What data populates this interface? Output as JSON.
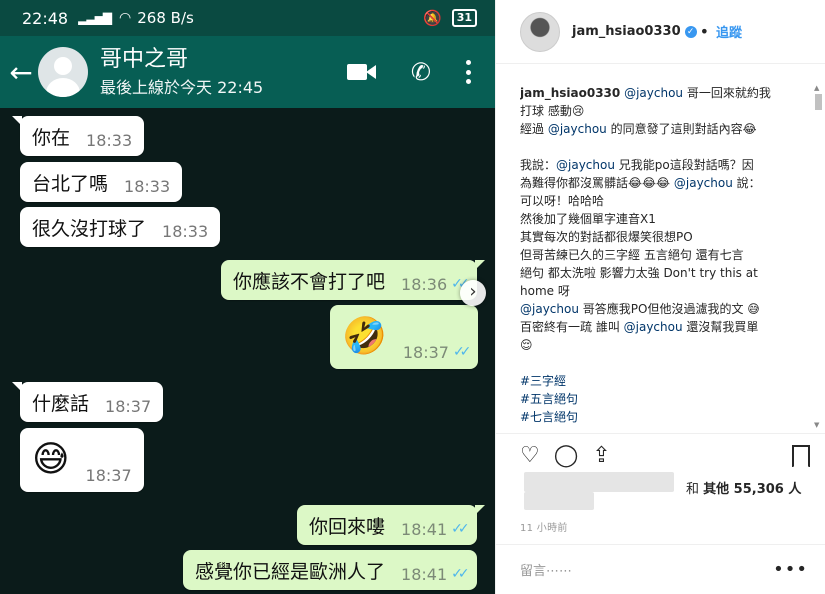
{
  "status_bar": {
    "time": "22:48",
    "data_rate": "268 B/s",
    "battery": "31"
  },
  "chat_header": {
    "back_icon": "arrow-left-icon",
    "contact_name": "哥中之哥",
    "last_seen": "最後上線於今天 22:45"
  },
  "messages": [
    {
      "side": "in",
      "text": "你在",
      "time": "18:33"
    },
    {
      "side": "in",
      "text": "台北了嗎",
      "time": "18:33"
    },
    {
      "side": "in",
      "text": "很久沒打球了",
      "time": "18:33"
    },
    {
      "side": "out",
      "text": "你應該不會打了吧",
      "time": "18:36",
      "ticks": "✓✓"
    },
    {
      "side": "out",
      "text": "🤣",
      "time": "18:37",
      "ticks": "✓✓"
    },
    {
      "side": "in",
      "text": "什麼話",
      "time": "18:37"
    },
    {
      "side": "in",
      "text": "😅",
      "time": "18:37"
    },
    {
      "side": "out",
      "text": "你回來嘍",
      "time": "18:41",
      "ticks": "✓✓"
    },
    {
      "side": "out",
      "text": "感覺你已經是歐洲人了",
      "time": "18:41",
      "ticks": "✓✓"
    }
  ],
  "instagram": {
    "username": "jam_hsiao0330",
    "follow_label": "追蹤",
    "caption": {
      "line1_user": "jam_hsiao0330",
      "line1_mention": "@jaychou",
      "line1_rest": " 哥一回來就約我",
      "line2": "打球 感動😢",
      "line3_a": "經過 ",
      "line3_mention": "@jaychou",
      "line3_b": " 的同意發了這則對話內容😂",
      "line4_a": "我說：",
      "line4_mention": "@jaychou",
      "line4_b": " 兄我能po這段對話嗎？因",
      "line5_a": "為難得你都沒罵髒話😂😂😂 ",
      "line5_mention": "@jaychou",
      "line5_b": " 說：",
      "line6": "可以呀！哈哈哈",
      "line7": "然後加了幾個單字連音X1",
      "line8": "其實每次的對話都很爆笑很想PO",
      "line9": "但哥苦練已久的三字經 五言絕句 還有七言",
      "line10": "絕句 都太洗啦 影響力太強 Don't try this at",
      "line11": "home 呀",
      "line12_mention": "@jaychou",
      "line12_b": " 哥答應我PO但他沒過濾我的文 😅",
      "line13_a": "百密終有一疏 誰叫 ",
      "line13_mention": "@jaychou",
      "line13_b": " 還沒幫我買單",
      "line14": "😌",
      "tag1": "#三字經",
      "tag2": "#五言絕句",
      "tag3": "#七言絕句"
    },
    "likes_prefix": "和 ",
    "likes_label": "其他 55,306 人",
    "timestamp": "11 小時前",
    "comment_placeholder": "留言⋯⋯",
    "more_label": "•••"
  }
}
